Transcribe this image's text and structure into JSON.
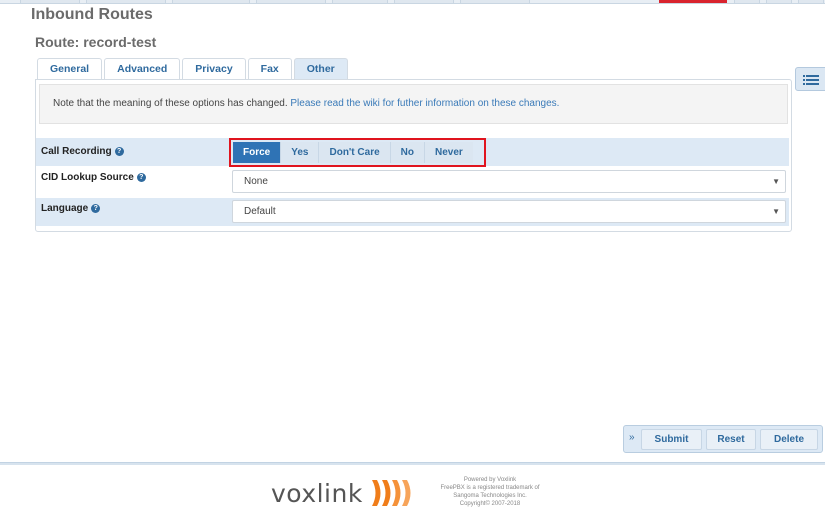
{
  "header": {
    "title": "Inbound Routes",
    "route_title": "Route: record-test"
  },
  "tabs": [
    {
      "label": "General"
    },
    {
      "label": "Advanced"
    },
    {
      "label": "Privacy"
    },
    {
      "label": "Fax"
    },
    {
      "label": "Other"
    }
  ],
  "notice": {
    "text": "Note that the meaning of these options has changed.",
    "link": "Please read the wiki for futher information on these changes."
  },
  "fields": {
    "call_recording": {
      "label": "Call Recording",
      "options": [
        "Force",
        "Yes",
        "Don't Care",
        "No",
        "Never"
      ],
      "selected": "Force"
    },
    "cid_lookup": {
      "label": "CID Lookup Source",
      "value": "None"
    },
    "language": {
      "label": "Language",
      "value": "Default"
    }
  },
  "actions": {
    "submit": "Submit",
    "reset": "Reset",
    "delete": "Delete"
  },
  "footer": {
    "logo": "voxlink",
    "line1": "Powered by Voxlink",
    "line2": "FreePBX is a registered trademark of",
    "line3": "Sangoma Technologies Inc.",
    "line4": "Copyright© 2007-2018"
  },
  "colors": {
    "accent": "#2f73b5",
    "highlight": "#e0141e",
    "logo_mark": "#f07d1a"
  }
}
